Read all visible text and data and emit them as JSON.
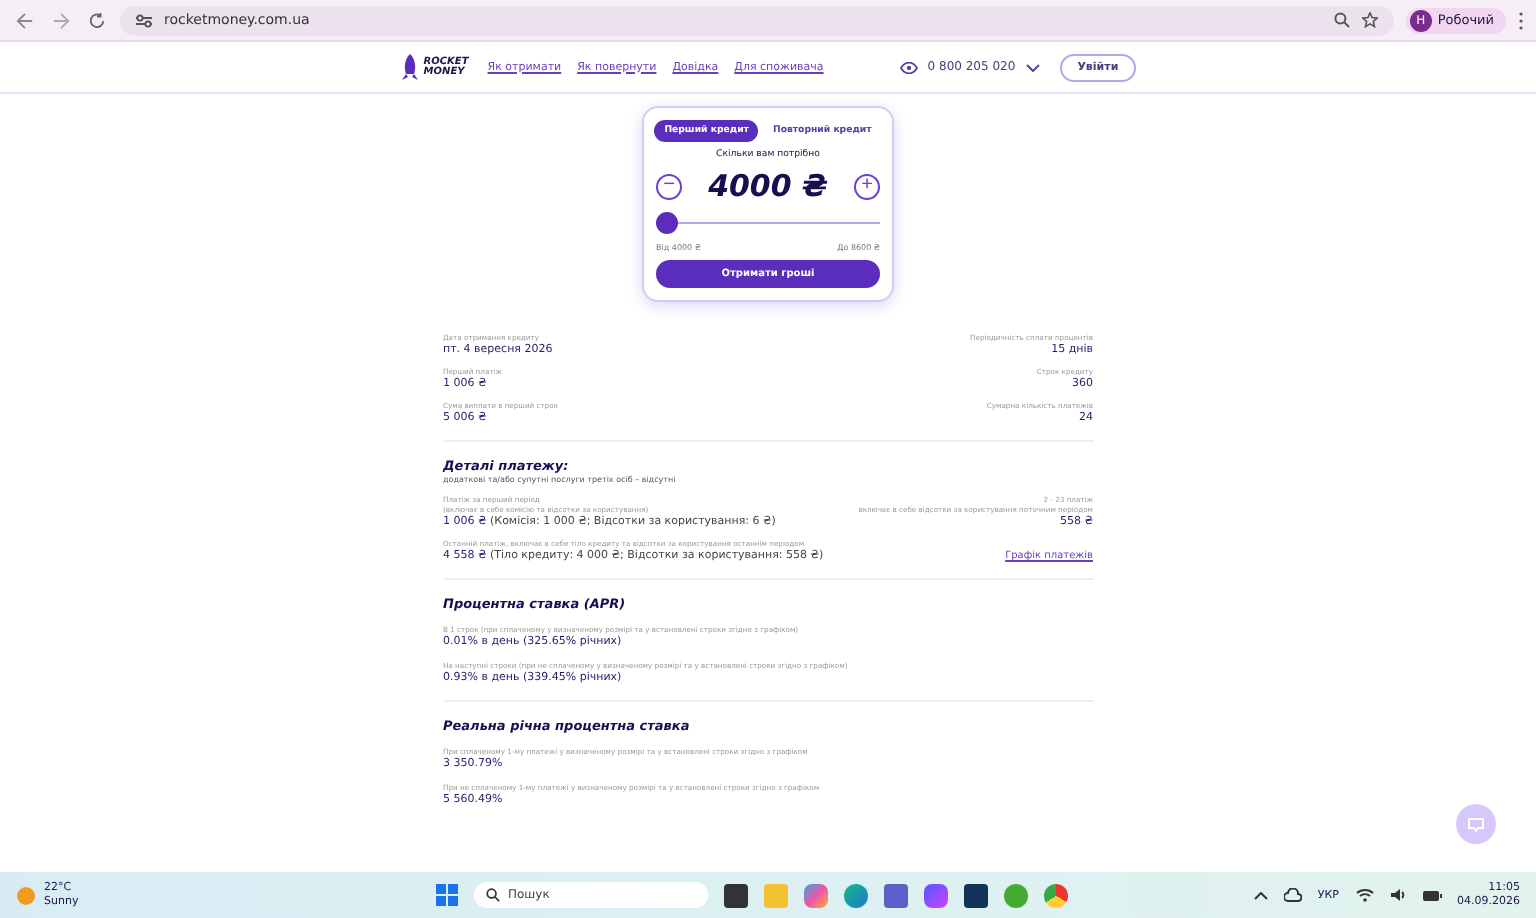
{
  "browser": {
    "url": "rocketmoney.com.ua",
    "profile_initial": "Н",
    "profile": "Робочий"
  },
  "header": {
    "logo": "ROCKET MONEY",
    "nav": [
      "Як отримати",
      "Як повернути",
      "Довідка",
      "Для споживача"
    ],
    "phone": "0 800 205 020",
    "login": "Увійти"
  },
  "calculator": {
    "tabs": [
      {
        "label": "Перший кредит",
        "selected": true
      },
      {
        "label": "Повторний кредит",
        "selected": false
      }
    ],
    "question": "Скільки вам потрібно",
    "minus": "−",
    "plus": "+",
    "amount": "4000 ₴",
    "slider": {
      "level": 0
    },
    "min_label": "Від 4000 ₴",
    "max_label": "До 8600 ₴",
    "submit": "Отримати гроші"
  },
  "summary": [
    {
      "label": "Дата отримання кредиту",
      "value": "пт. 4 вересня 2026"
    },
    {
      "label": "Періодичність сплати процентів",
      "value": "15 днів"
    },
    {
      "label": "Перший платіж",
      "value": "1 006 ₴"
    },
    {
      "label": "Строк кредиту",
      "value": "360"
    },
    {
      "label": "Сума виплати в перший строк",
      "value": "5 006 ₴"
    },
    {
      "label": "Сумарна кількість платежів",
      "value": "24"
    }
  ],
  "payment_details": {
    "title": "Деталі платежу:",
    "subtitle": "додаткові та/або супутні послуги третіх осіб – відсутні",
    "first": {
      "label": "Платіж за перший період",
      "note": "(включає в себе комісію та відсотки за користування)",
      "amount": "1 006 ₴",
      "breakdown": "(Комісія: 1 000 ₴; Відсотки за користування: 6 ₴)"
    },
    "middle": {
      "label": "2 - 23 платіж",
      "note": "включає в себе відсотки за користування поточним періодом",
      "amount": "558 ₴"
    },
    "last": {
      "label": "Останній платіж, включає в себе тіло кредиту та відсотки за користування останнім періодом",
      "amount": "4 558 ₴",
      "breakdown": "(Тіло кредиту: 4 000 ₴; Відсотки за користування: 558 ₴)"
    },
    "schedule_link": "Графік платежів"
  },
  "sections": [
    {
      "title": "Процентна ставка (APR)",
      "rows": [
        {
          "label": "В 1 строк (при сплаченому у визначеному розмірі та у встановлені строки згідно з графіком)",
          "value": "0.01% в день (325.65% річних)"
        },
        {
          "label": "На наступні строки (при не сплаченому у визначеному розмірі та у встановлені строки згідно з графіком)",
          "value": "0.93% в день (339.45% річних)"
        }
      ]
    },
    {
      "title": "Реальна річна процентна ставка",
      "rows": [
        {
          "label": "При сплаченому 1-му платежі у визначеному розмірі та у встановлені строки згідно з графіком",
          "value": "3 350.79%"
        },
        {
          "label": "При не сплаченому 1-му платежі у визначеному розмірі та у встановлені строки згідно з графіком",
          "value": "5 560.49%"
        }
      ]
    }
  ],
  "taskbar": {
    "temperature": "22°C",
    "weather": "Sunny",
    "search_placeholder": "Пошук",
    "language": "УКР",
    "time": "11:05",
    "date": "04.09.2026"
  }
}
